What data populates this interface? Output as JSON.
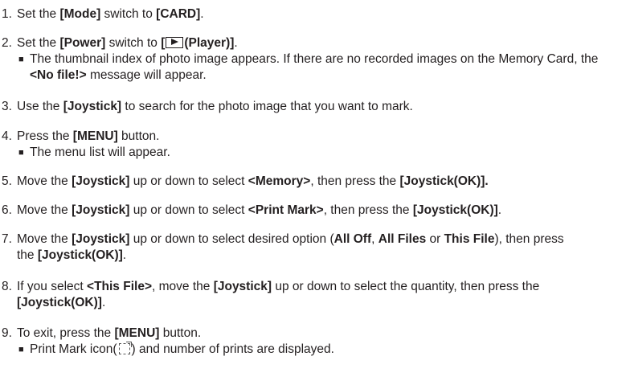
{
  "steps": [
    {
      "num": "1.",
      "p": [
        "Set the ",
        "[Mode]",
        " switch to ",
        "[CARD]",
        "."
      ]
    },
    {
      "num": "2.",
      "p": [
        "Set the ",
        "[Power]",
        " switch to ",
        "[",
        "(Player)]",
        "."
      ],
      "sub": [
        "The thumbnail index of photo image appears. If there are no recorded images on the Memory Card, the ",
        "<No file!>",
        " message will appear."
      ]
    },
    {
      "num": "3.",
      "p": [
        "Use the ",
        "[Joystick]",
        " to search for the photo image that you want to mark."
      ]
    },
    {
      "num": "4.",
      "p": [
        "Press the ",
        "[MENU]",
        " button."
      ],
      "sub": [
        "The menu list will appear."
      ]
    },
    {
      "num": "5.",
      "p": [
        "Move the ",
        "[Joystick]",
        " up or down to select ",
        "<Memory>",
        ", then press the ",
        "[Joystick(OK)]."
      ]
    },
    {
      "num": "6.",
      "p": [
        "Move the ",
        "[Joystick]",
        " up or down to select ",
        "<Print Mark>",
        ", then press the ",
        "[Joystick(OK)]",
        "."
      ]
    },
    {
      "num": "7.",
      "p": [
        "Move the ",
        "[Joystick]",
        " up or down to select desired option (",
        "All Off",
        ", ",
        "All Files",
        " or ",
        "This File",
        "), then press the ",
        "[Joystick(OK)]",
        "."
      ]
    },
    {
      "num": "8.",
      "p": [
        "If you select ",
        "<This File>",
        ", move the ",
        "[Joystick]",
        " up or down to select the quantity, then press the ",
        "[Joystick(OK)]",
        "."
      ]
    },
    {
      "num": "9.",
      "p": [
        "To exit, press the ",
        "[MENU]",
        " button."
      ],
      "sub": [
        "Print Mark icon(",
        ") and number of prints are displayed."
      ]
    }
  ],
  "icons": {
    "player": "play-icon",
    "print_mark": "print-mark-icon"
  }
}
